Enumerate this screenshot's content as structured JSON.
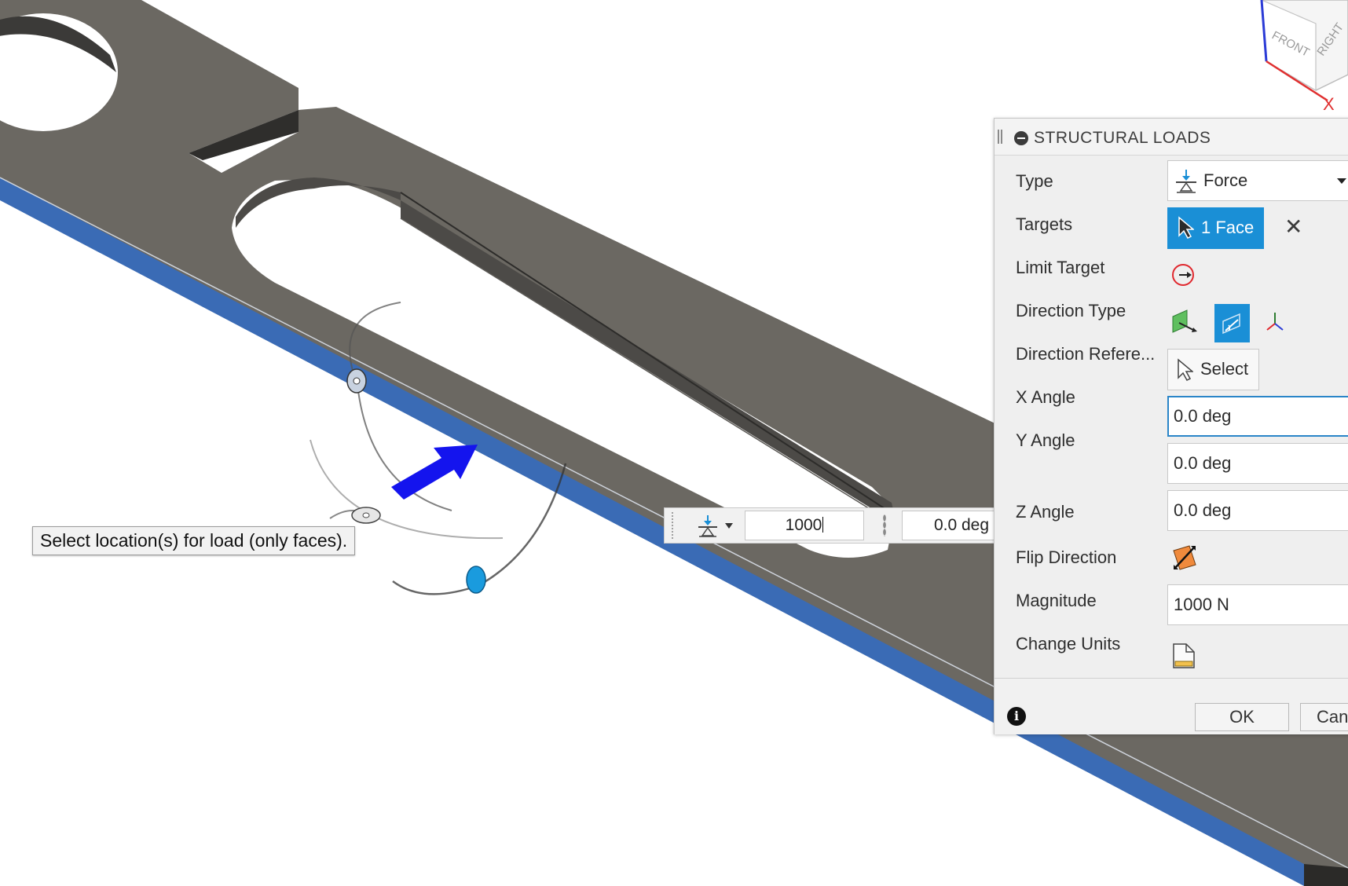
{
  "dialog": {
    "title": "STRUCTURAL LOADS",
    "type": {
      "label": "Type",
      "value": "Force"
    },
    "targets": {
      "label": "Targets",
      "value": "1 Face"
    },
    "limit_target": {
      "label": "Limit Target"
    },
    "direction_type": {
      "label": "Direction Type",
      "selected": "custom"
    },
    "direction_reference": {
      "label": "Direction Refere...",
      "button": "Select"
    },
    "x_angle": {
      "label": "X Angle",
      "value": "0.0 deg"
    },
    "y_angle": {
      "label": "Y Angle",
      "value": "0.0 deg"
    },
    "z_angle": {
      "label": "Z Angle",
      "value": "0.0 deg"
    },
    "flip_direction": {
      "label": "Flip Direction"
    },
    "magnitude": {
      "label": "Magnitude",
      "value": "1000 N"
    },
    "change_units": {
      "label": "Change Units"
    },
    "ok_label": "OK",
    "cancel_label": "Can"
  },
  "hint": "Select location(s) for load (only faces).",
  "hud": {
    "magnitude": "1000",
    "angle": "0.0 deg"
  },
  "viewcube": {
    "front": "FRONT",
    "right": "RIGHT",
    "axis": "X"
  },
  "colors": {
    "accent": "#1a8fd6",
    "part_top": "#6b6862",
    "part_side": "#3f3d3a",
    "selected_face": "#3a6bb5",
    "arrow": "#1a1af0",
    "limit_icon": "#e0282e"
  }
}
